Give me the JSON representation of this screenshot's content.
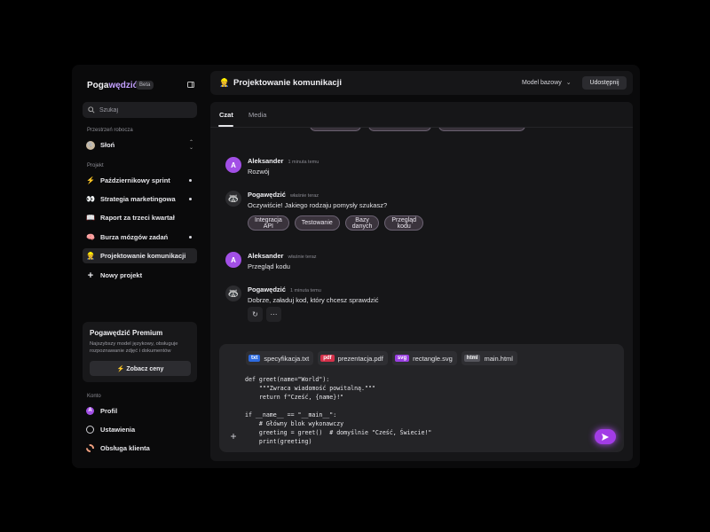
{
  "app": {
    "brand_prefix": "Poga",
    "brand_accent": "wędzić",
    "beta": "Beta"
  },
  "sidebar": {
    "search_placeholder": "Szukaj",
    "workspace_label": "Przestrzeń robocza",
    "workspace": {
      "name": "Słoń",
      "icon": "elephant-avatar"
    },
    "project_label": "Projekt",
    "projects": [
      {
        "label": "Październikowy sprint",
        "icon": "lightning-icon",
        "glyph": "⚡",
        "dot": true
      },
      {
        "label": "Strategia marketingowa",
        "icon": "eyes-icon",
        "glyph": "👀",
        "dot": true
      },
      {
        "label": "Raport za trzeci kwartał",
        "icon": "book-icon",
        "glyph": "📖",
        "dot": false
      },
      {
        "label": "Burza mózgów zadań",
        "icon": "brain-icon",
        "glyph": "🧠",
        "dot": true
      },
      {
        "label": "Projektowanie komunikacji",
        "icon": "construction-worker-icon",
        "glyph": "👷",
        "dot": false,
        "active": true
      }
    ],
    "new_project": "Nowy projekt",
    "premium": {
      "title": "Pogawędzić Premium",
      "description": "Najszybszy model językowy, obsługuje rozpoznawanie zdjęć i dokumentów",
      "button": "Zobacz ceny"
    },
    "account_label": "Konto",
    "account": [
      {
        "label": "Profil",
        "icon": "profile-icon"
      },
      {
        "label": "Ustawienia",
        "icon": "settings-icon"
      },
      {
        "label": "Obsługa klienta",
        "icon": "support-icon"
      }
    ]
  },
  "header": {
    "icon": "construction-worker-icon",
    "title": "Projektowanie komunikacji",
    "model": "Model bazowy",
    "share": "Udostępnij"
  },
  "tabs": [
    {
      "label": "Czat",
      "active": true
    },
    {
      "label": "Media",
      "active": false
    }
  ],
  "messages": [
    {
      "author": "Aleksander",
      "initial": "A",
      "time": "1 minuta temu",
      "text": "Rozwój",
      "role": "user"
    },
    {
      "author": "Pogawędzić",
      "time": "właśnie teraz",
      "text": "Oczywiście! Jakiego rodzaju pomysły szukasz?",
      "role": "bot",
      "chips": [
        "Integracja API",
        "Testowanie",
        "Bazy danych",
        "Przegląd kodu"
      ]
    },
    {
      "author": "Aleksander",
      "initial": "A",
      "time": "właśnie teraz",
      "text": "Przegląd kodu",
      "role": "user"
    },
    {
      "author": "Pogawędzić",
      "time": "1 minuta temu",
      "text": "Dobrze, załaduj kod, który chcesz sprawdzić",
      "role": "bot"
    }
  ],
  "composer": {
    "files": [
      {
        "ext": "txt",
        "name": "specyfikacja.txt",
        "color": "#2d6be0"
      },
      {
        "ext": "pdf",
        "name": "prezentacja.pdf",
        "color": "#d5314a"
      },
      {
        "ext": "svg",
        "name": "rectangle.svg",
        "color": "#9a3fe0"
      },
      {
        "ext": "html",
        "name": "main.html",
        "color": "#55555c"
      }
    ],
    "code": "def greet(name=\"World\"):\n    \"\"\"Zwraca wiadomość powitalną.\"\"\"\n    return f\"Cześć, {name}!\"\n\nif __name__ == \"__main__\":\n    # Główny blok wykonawczy\n    greeting = greet()  # domyślnie \"Cześć, Świecie!\"\n    print(greeting)"
  },
  "colors": {
    "accent": "#a23ce6",
    "user_avatar": "#a24fe6",
    "brand_accent": "#c3a0ff"
  }
}
